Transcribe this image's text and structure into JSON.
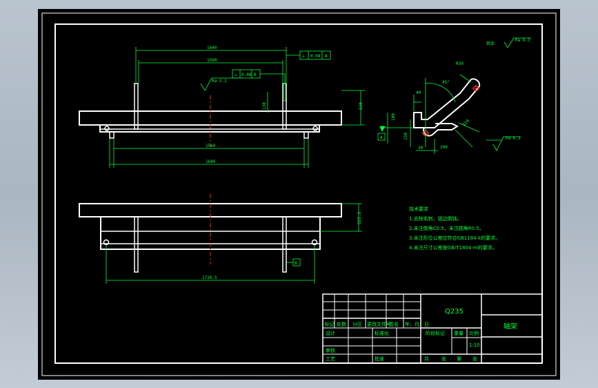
{
  "drawing": {
    "roughness_all": "其余",
    "roughness_all_value": "Ra 6.3",
    "front_view": {
      "dim_top_outer": "1640",
      "dim_top_inner": "1560",
      "dim_bottom_inner": "1560",
      "dim_bottom_outer": "1680",
      "dim_height": "520",
      "dim_side_small": "130",
      "tolerance_1": {
        "symbol": "⊥",
        "value": "0.04",
        "datum": "A"
      },
      "tolerance_2": {
        "symbol": "⊥",
        "value": "0.08",
        "datum": "B"
      },
      "roughness": "Ra 3.2"
    },
    "side_view": {
      "dim_r": "R50",
      "dim_angle": "45°",
      "dim_40": "40",
      "dim_100": "100",
      "dim_150": "150",
      "dim_30": "30",
      "dim_200": "200",
      "dim_120": "120",
      "datum": "A",
      "roughness": "Ra 6.3"
    },
    "bottom_view": {
      "dim_height": "525.5",
      "dim_width": "1720.5",
      "datum": "B"
    },
    "notes": {
      "title": "技术要求",
      "items": [
        "1.去除毛刺，锐边倒钝。",
        "2.未注倒角C0.5，未注圆角R0.5。",
        "3.未注形位公差应符合GB1184-k的要求。",
        "4.未注尺寸公差按GB/T1804-m的要求。"
      ]
    },
    "title_block": {
      "material": "Q235",
      "part_name": "轴架",
      "scale": "1:10",
      "header_row": [
        "标记",
        "处数",
        "分区",
        "更改文件号",
        "签名",
        "年、月、日"
      ],
      "designer": "设计",
      "standardization": "标准化",
      "stage": "阶段标记",
      "weight": "重量",
      "scale_label": "比例",
      "review": "审核",
      "process": "工艺",
      "approve": "批准",
      "sheet_row": [
        "共",
        "张",
        "第",
        "张"
      ]
    }
  }
}
